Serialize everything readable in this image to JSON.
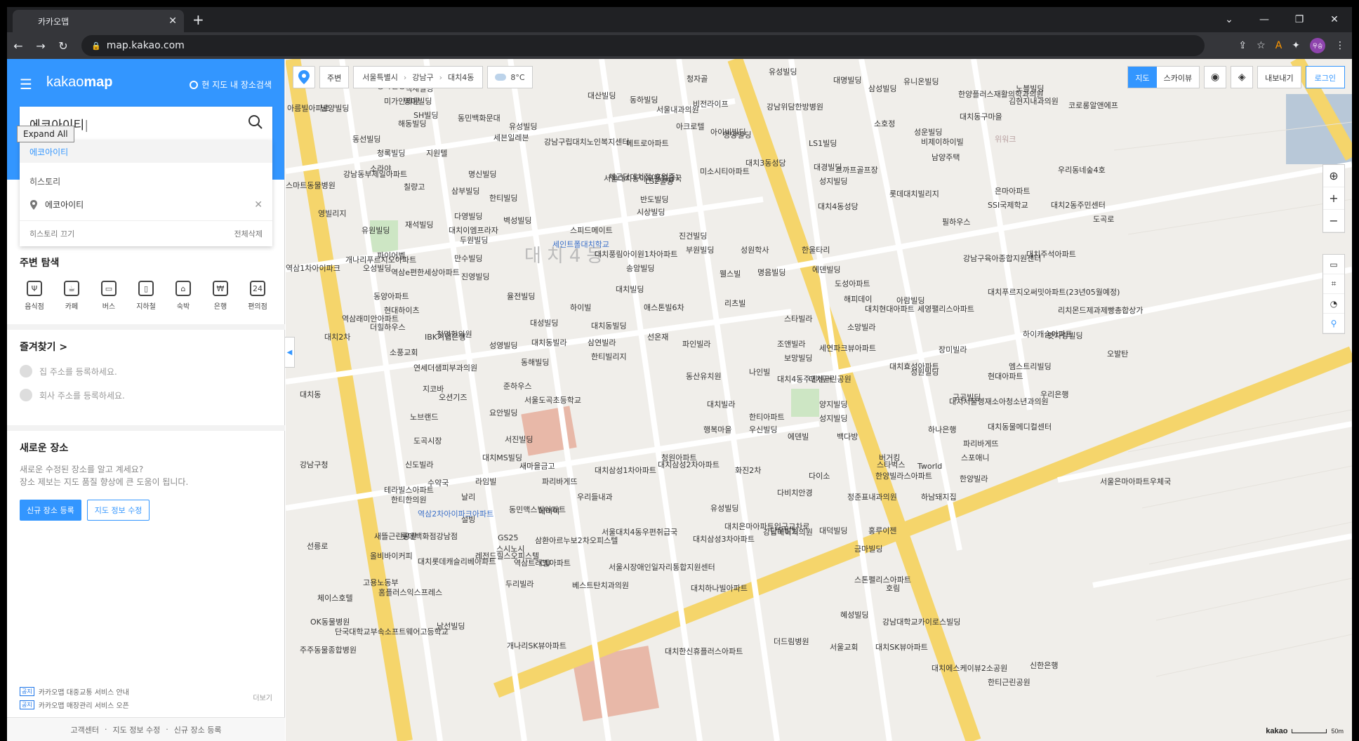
{
  "browser": {
    "tab_title": "카카오맵",
    "url": "map.kakao.com",
    "profile_initials": "우승"
  },
  "panel": {
    "logo_light": "kakao",
    "logo_bold": "map",
    "map_area_search": "현 지도 내 장소검색",
    "search_value": "에코아이티",
    "tooltip": "Expand All",
    "suggestion": "에코아이티",
    "history_title": "히스토리",
    "history_items": [
      "에코아이티"
    ],
    "history_off": "히스토리 끄기",
    "history_clear": "전체삭제",
    "explore_title": "주변 탐색",
    "explore_items": [
      "음식점",
      "카페",
      "버스",
      "지하철",
      "숙박",
      "은행",
      "편의점"
    ],
    "favorites_title": "즐겨찾기 >",
    "favorites_home": "집 주소를 등록하세요.",
    "favorites_work": "회사 주소를 등록하세요.",
    "newplace_title": "새로운 장소",
    "newplace_desc1": "새로운 수정된 장소를 알고 계세요?",
    "newplace_desc2": "장소 제보는 지도 품질 향상에 큰 도움이 됩니다.",
    "btn_register": "신규 장소 등록",
    "btn_edit": "지도 정보 수정",
    "notice_more": "더보기",
    "notice_1": "카카오맵 대중교통 서비스 안내",
    "notice_2": "카카오맵 매장관리 서비스 오픈",
    "notice_tag_1": "공지",
    "notice_tag_2": "공지",
    "footer": [
      "고객센터",
      "지도 정보 수정",
      "신규 장소 등록"
    ]
  },
  "map": {
    "surround_label": "주변",
    "breadcrumb": [
      "서울특별시",
      "강남구",
      "대치4동"
    ],
    "temperature": "8°C",
    "mode_map": "지도",
    "mode_skyview": "스카이뷰",
    "export_label": "내보내기",
    "login_label": "로그인",
    "scale_brand": "kakao",
    "scale_unit": "50m",
    "district_label": "대치4동",
    "labels": [
      {
        "t": "동아빌딩"
      },
      {
        "t": "세븐일레븐"
      },
      {
        "t": "강남구립대치노인복지센터"
      },
      {
        "t": "메트로아파트"
      },
      {
        "t": "아이비빌딩"
      },
      {
        "t": "LS1빌딩"
      },
      {
        "t": "대경빌딩"
      },
      {
        "t": "성지빌딩"
      },
      {
        "t": "서울대치동아우편취급국"
      },
      {
        "t": "미소시티아파트"
      },
      {
        "t": "반도빌딩"
      },
      {
        "t": "대치4동성당"
      },
      {
        "t": "스피드메이트"
      },
      {
        "t": "시상빌딩"
      },
      {
        "t": "세인트폴대치학교"
      },
      {
        "t": "대치풍림아이원1차아파트"
      },
      {
        "t": "진건빌딩"
      },
      {
        "t": "부원빌딩"
      },
      {
        "t": "성원학사"
      },
      {
        "t": "한울타리"
      },
      {
        "t": "송암빌딩"
      },
      {
        "t": "웰스빌"
      },
      {
        "t": "명음빌딩"
      },
      {
        "t": "에덴빌딩"
      },
      {
        "t": "도성아파트"
      },
      {
        "t": "대치빌딩"
      },
      {
        "t": "애스톤빌6차"
      },
      {
        "t": "리츠빌"
      },
      {
        "t": "스타빌라"
      },
      {
        "t": "해피데이"
      },
      {
        "t": "아람빌딩"
      },
      {
        "t": "선온재"
      },
      {
        "t": "파인빌라"
      },
      {
        "t": "조앤빌라"
      },
      {
        "t": "세연파크뷰아파트"
      },
      {
        "t": "소망빌라"
      },
      {
        "t": "대치동빌딩"
      },
      {
        "t": "한티빌리지"
      },
      {
        "t": "동산유치원"
      },
      {
        "t": "나인빌"
      },
      {
        "t": "대치4동주민센터"
      },
      {
        "t": "대치근린공원"
      },
      {
        "t": "서울도곡초등학교"
      },
      {
        "t": "대치빌라"
      },
      {
        "t": "양지빌딩"
      },
      {
        "t": "성지빌딩"
      },
      {
        "t": "행복마을"
      },
      {
        "t": "한티아파트"
      },
      {
        "t": "에덴빌"
      },
      {
        "t": "백다방"
      },
      {
        "t": "청원아파트"
      },
      {
        "t": "다이소"
      },
      {
        "t": "버거킹"
      },
      {
        "t": "화진2차"
      },
      {
        "t": "다비치안경"
      },
      {
        "t": "정준표내과의원"
      },
      {
        "t": "유성빌딩"
      },
      {
        "t": "단우빌딩"
      },
      {
        "t": "대덕빌딩"
      },
      {
        "t": "홍루이젠"
      },
      {
        "t": "서울대치4동우편취급국"
      },
      {
        "t": "삼환아르누보2차오피스텔"
      },
      {
        "t": "서울시장애인일자리통합지원센터"
      },
      {
        "t": "대치현대아파트"
      },
      {
        "t": "세영팰리스아파트"
      },
      {
        "t": "장미빌라"
      },
      {
        "t": "대치효성아파트"
      },
      {
        "t": "현대아파트"
      },
      {
        "t": "우리은행"
      },
      {
        "t": "스타벅스"
      },
      {
        "t": "Tworld"
      },
      {
        "t": "스포애니"
      },
      {
        "t": "한양빌라"
      },
      {
        "t": "하나은행"
      },
      {
        "t": "대치서울영재소아청소년과의원"
      },
      {
        "t": "대치동물메디컬센터"
      },
      {
        "t": "파리바게뜨"
      },
      {
        "t": "하남돼지집"
      },
      {
        "t": "금마빌딩"
      },
      {
        "t": "스톤펠리스아파트"
      },
      {
        "t": "호림"
      },
      {
        "t": "혜성빌딩"
      },
      {
        "t": "강남대학교카이로스빌딩"
      },
      {
        "t": "서울교회"
      },
      {
        "t": "대치SK뷰아파트"
      },
      {
        "t": "대치에스케이뷰2소공원"
      },
      {
        "t": "한티근린공원"
      },
      {
        "t": "신한은행"
      },
      {
        "t": "서울은마아파트우체국"
      },
      {
        "t": "은마아파트"
      },
      {
        "t": "대치2동주민센터"
      },
      {
        "t": "롯데대치빌리지"
      },
      {
        "t": "우리동네숲4호"
      },
      {
        "t": "SSI국제학교"
      },
      {
        "t": "필하우스"
      },
      {
        "t": "남양주택"
      },
      {
        "t": "르까프골프장"
      },
      {
        "t": "비제이하이빌"
      },
      {
        "t": "대치3동성당"
      },
      {
        "t": "강남구육아종합지원센터"
      },
      {
        "t": "대치주석아파트"
      },
      {
        "t": "대치푸르지오써밋아파트(23년05월예정)"
      },
      {
        "t": "리치몬드제과제빵총합상가"
      },
      {
        "t": "하이캐슬아파트"
      },
      {
        "t": "맛자랑빌딩"
      },
      {
        "t": "오발탄"
      },
      {
        "t": "엠스트리빌딩"
      },
      {
        "t": "구공빌딩"
      },
      {
        "t": "성원빌딩"
      },
      {
        "t": "보망빌딩"
      },
      {
        "t": "우신빌딩"
      },
      {
        "t": "한양빌라스아파트"
      },
      {
        "t": "대치은마아파트입구교차로"
      },
      {
        "t": "강남메이지의원"
      },
      {
        "t": "대치삼성3차아파트"
      },
      {
        "t": "대치하나빌아파트"
      },
      {
        "t": "대치삼성2차아파트"
      },
      {
        "t": "대치삼성1차아파트"
      },
      {
        "t": "유성빌딩"
      },
      {
        "t": "대명빌딩"
      },
      {
        "t": "삼성빌딩"
      },
      {
        "t": "한양플러스재활의학과의원"
      },
      {
        "t": "김현지내과의원"
      },
      {
        "t": "코로롱알앤에프"
      },
      {
        "t": "노블빌딩"
      },
      {
        "t": "채근담대치점(휴업중)"
      },
      {
        "t": "LS2빌딩"
      },
      {
        "t": "영미빌딩"
      },
      {
        "t": "SH빌딩"
      },
      {
        "t": "동민백화문대"
      },
      {
        "t": "백제빌딩"
      },
      {
        "t": "유성빌딩"
      },
      {
        "t": "대산빌딩"
      },
      {
        "t": "동하빌딩"
      },
      {
        "t": "서울내과의원"
      },
      {
        "t": "청자골"
      },
      {
        "t": "비전라이프"
      },
      {
        "t": "아크로텔"
      },
      {
        "t": "영양빌딩"
      },
      {
        "t": "강남위담한방병원"
      },
      {
        "t": "소호정"
      },
      {
        "t": "유니온빌딩"
      },
      {
        "t": "성운빌딩"
      },
      {
        "t": "대치동구마을"
      },
      {
        "t": "위워크"
      },
      {
        "t": "아름빌아파트"
      },
      {
        "t": "남양빌딩"
      },
      {
        "t": "미가인의원"
      },
      {
        "t": "해동빌딩"
      },
      {
        "t": "동선빌딩"
      },
      {
        "t": "청록빌딩"
      },
      {
        "t": "지원텔"
      },
      {
        "t": "명신빌딩"
      },
      {
        "t": "한티빌딩"
      },
      {
        "t": "칠량고"
      },
      {
        "t": "삼부빌딩"
      },
      {
        "t": "소라야"
      },
      {
        "t": "강남동부제일아파트"
      },
      {
        "t": "스마트동물병원"
      },
      {
        "t": "영빌리지"
      },
      {
        "t": "유원빌딩"
      },
      {
        "t": "다영빌딩"
      },
      {
        "t": "벽성빌딩"
      },
      {
        "t": "두원빌딩"
      },
      {
        "t": "만수빌딩"
      },
      {
        "t": "진영빌딩"
      },
      {
        "t": "율전빌딩"
      },
      {
        "t": "하이빌"
      },
      {
        "t": "대성빌딩"
      },
      {
        "t": "성영빌딩"
      },
      {
        "t": "대치동빌라"
      },
      {
        "t": "삼연빌라"
      },
      {
        "t": "동해빌딩"
      },
      {
        "t": "준하우스"
      },
      {
        "t": "요안빌딩"
      },
      {
        "t": "서진빌딩"
      },
      {
        "t": "라임빌"
      },
      {
        "t": "날리"
      },
      {
        "t": "새마을금고"
      },
      {
        "t": "파리바게뜨"
      },
      {
        "t": "설빙"
      },
      {
        "t": "동민맥스빌아파트"
      },
      {
        "t": "에머이"
      },
      {
        "t": "우리들내과"
      },
      {
        "t": "GS25"
      },
      {
        "t": "CU"
      },
      {
        "t": "스시노시"
      },
      {
        "t": "대치MS빌딩"
      },
      {
        "t": "재석빌딩"
      },
      {
        "t": "대치이엠프라자"
      },
      {
        "t": "파이어벨"
      },
      {
        "t": "오성빌딩"
      },
      {
        "t": "동양아파트"
      },
      {
        "t": "현대하이츠"
      },
      {
        "t": "더힐하우스"
      },
      {
        "t": "IBK기업은행"
      },
      {
        "t": "소풍교회"
      },
      {
        "t": "청명한의원"
      },
      {
        "t": "연세더샘피부과의원"
      },
      {
        "t": "지코바"
      },
      {
        "t": "오션기즈"
      },
      {
        "t": "노브랜드"
      },
      {
        "t": "도곡시장"
      },
      {
        "t": "신도빌라"
      },
      {
        "t": "수약국"
      },
      {
        "t": "한티한의원"
      },
      {
        "t": "역삼2차아이파크아파트"
      },
      {
        "t": "테라빌스아파트"
      },
      {
        "t": "새뜰근린공원"
      },
      {
        "t": "롯데백화점강남점"
      },
      {
        "t": "올비바이커피"
      },
      {
        "t": "대치롯데캐슬리베아파트"
      },
      {
        "t": "고용노동부"
      },
      {
        "t": "레전드힐스오피스텔"
      },
      {
        "t": "역삼트레벨아파트"
      },
      {
        "t": "두리빌라"
      },
      {
        "t": "베스트탄치과의원"
      },
      {
        "t": "홈플러스익스프레스"
      },
      {
        "t": "체이스호텔"
      },
      {
        "t": "OK동물병원"
      },
      {
        "t": "단국대학교부속소프트웨어고등학교"
      },
      {
        "t": "남선빌딩"
      },
      {
        "t": "개나리SK뷰아파트"
      },
      {
        "t": "주주동물종합병원"
      },
      {
        "t": "대치한신휴플러스아파트"
      },
      {
        "t": "더드림병원"
      },
      {
        "t": "역삼1차아이파크"
      },
      {
        "t": "개나리푸르지오아파트"
      },
      {
        "t": "역삼e편한세상아파트"
      },
      {
        "t": "역삼래미안아파트"
      },
      {
        "t": "대치2차"
      },
      {
        "t": "대치동"
      },
      {
        "t": "강남구청"
      },
      {
        "t": "선릉로"
      },
      {
        "t": "도곡로"
      }
    ]
  }
}
